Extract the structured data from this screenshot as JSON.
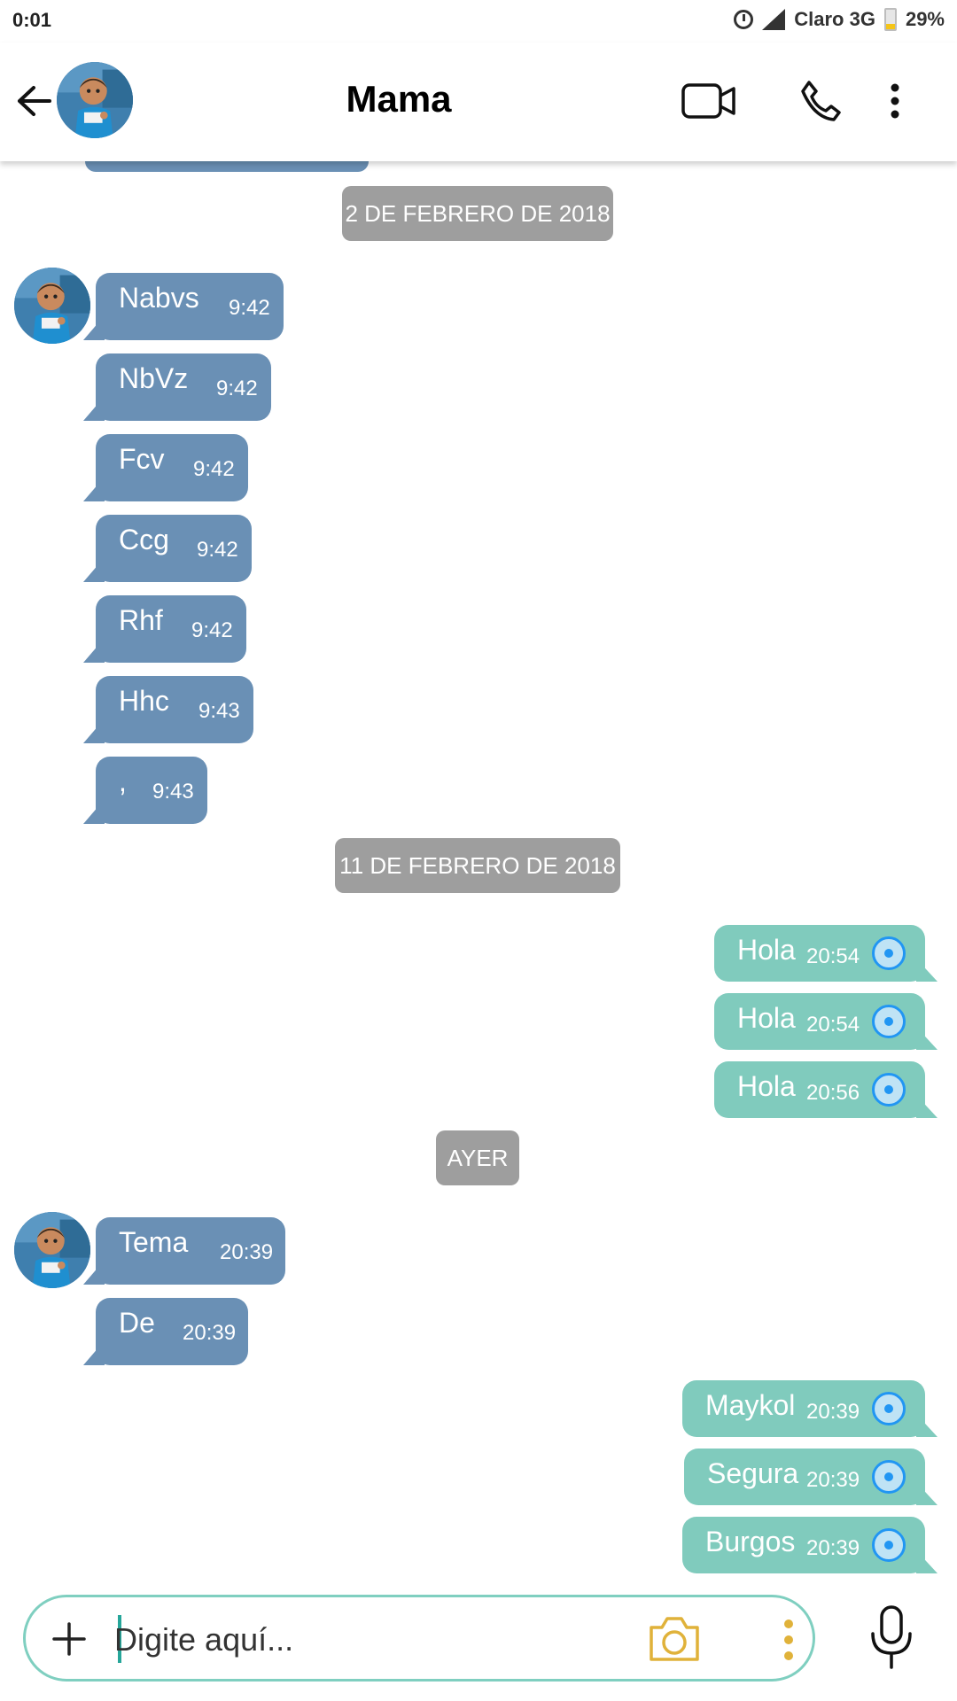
{
  "status_bar": {
    "time": "0:01",
    "carrier": "Claro 3G",
    "battery": "29%",
    "battery_level": 0.29
  },
  "header": {
    "title": "Mama",
    "icons": [
      "back-arrow-icon",
      "video-call-icon",
      "phone-icon",
      "more-vert-icon"
    ]
  },
  "chat": {
    "dates": [
      "2 DE FEBRERO DE 2018",
      "11 DE FEBRERO DE 2018",
      "AYER"
    ],
    "messages": [
      {
        "text": "Nabvs",
        "time": "9:42",
        "direction": "in"
      },
      {
        "text": "NbVz",
        "time": "9:42",
        "direction": "in"
      },
      {
        "text": "Fcv",
        "time": "9:42",
        "direction": "in"
      },
      {
        "text": "Ccg",
        "time": "9:42",
        "direction": "in"
      },
      {
        "text": "Rhf",
        "time": "9:42",
        "direction": "in"
      },
      {
        "text": "Hhc",
        "time": "9:43",
        "direction": "in"
      },
      {
        "text": ",",
        "time": "9:43",
        "direction": "in"
      },
      {
        "text": "Hola",
        "time": "20:54",
        "direction": "out"
      },
      {
        "text": "Hola",
        "time": "20:54",
        "direction": "out"
      },
      {
        "text": "Hola",
        "time": "20:56",
        "direction": "out"
      },
      {
        "text": "Tema",
        "time": "20:39",
        "direction": "in"
      },
      {
        "text": "De",
        "time": "20:39",
        "direction": "in"
      },
      {
        "text": "Maykol",
        "time": "20:39",
        "direction": "out"
      },
      {
        "text": "Segura",
        "time": "20:39",
        "direction": "out"
      },
      {
        "text": "Burgos",
        "time": "20:39",
        "direction": "out"
      }
    ]
  },
  "composer": {
    "placeholder": "Digite aquí..."
  },
  "colors": {
    "incoming": "#6a90b5",
    "outgoing": "#80cbbd",
    "date_chip": "#9e9e9e",
    "accent": "#26a69a"
  }
}
